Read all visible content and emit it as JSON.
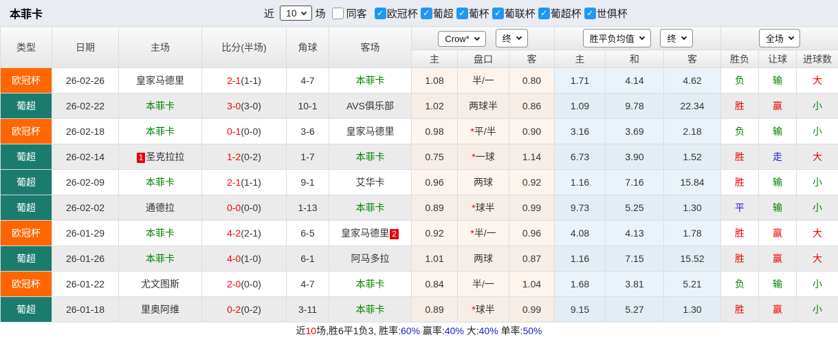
{
  "title": "本菲卡",
  "controls": {
    "recent_label": "近",
    "recent_value": "10",
    "matches_label": "场",
    "same_venue_label": "同客",
    "same_venue_checked": false,
    "leagues": [
      {
        "label": "欧冠杯",
        "checked": true
      },
      {
        "label": "葡超",
        "checked": true
      },
      {
        "label": "葡杯",
        "checked": true
      },
      {
        "label": "葡联杯",
        "checked": true
      },
      {
        "label": "葡超杯",
        "checked": true
      },
      {
        "label": "世俱杯",
        "checked": true
      }
    ]
  },
  "icons": {
    "check": "✓",
    "chevron_down": "v"
  },
  "colors": {
    "league": {
      "欧冠杯": "#ff6600",
      "葡超": "#1b7b6f"
    },
    "text": {
      "black": "#222222",
      "red": "#ee0000",
      "blue": "#1b1bcf",
      "green": "#008000"
    },
    "highlight_team": "#008000",
    "score_main": "#ff0000",
    "score_half": "#333333",
    "badge_bg": "#e60012"
  },
  "table": {
    "columns": {
      "type": "类型",
      "date": "日期",
      "home": "主场",
      "score": "比分(半场)",
      "corners": "角球",
      "away": "客场",
      "odds_home": "主",
      "odds_line": "盘口",
      "odds_away": "客",
      "avg_home": "主",
      "avg_draw": "和",
      "avg_away": "客",
      "result": "胜负",
      "handicap": "让球",
      "goals": "进球数"
    },
    "dropdowns": {
      "bookmaker": "Crow*",
      "odds_time": "终",
      "avg_metric": "胜平负均值",
      "avg_time": "终",
      "scope": "全场"
    },
    "rows": [
      {
        "league": "欧冠杯",
        "date": "26-02-26",
        "home": {
          "name": "皇家马德里",
          "hl": false
        },
        "score": "2-1",
        "half": "(1-1)",
        "corners": "4-7",
        "away": {
          "name": "本菲卡",
          "hl": true
        },
        "odds": [
          "1.08",
          "半/一",
          "0.80"
        ],
        "avg": [
          "1.71",
          "4.14",
          "4.62"
        ],
        "results": [
          {
            "text": "负",
            "color": "green"
          },
          {
            "text": "输",
            "color": "green"
          },
          {
            "text": "大",
            "color": "red"
          }
        ]
      },
      {
        "league": "葡超",
        "date": "26-02-22",
        "home": {
          "name": "本菲卡",
          "hl": true
        },
        "score": "3-0",
        "half": "(3-0)",
        "corners": "10-1",
        "away": {
          "name": "AVS俱乐部",
          "hl": false
        },
        "odds": [
          "1.02",
          "两球半",
          "0.86"
        ],
        "avg": [
          "1.09",
          "9.78",
          "22.34"
        ],
        "results": [
          {
            "text": "胜",
            "color": "red"
          },
          {
            "text": "赢",
            "color": "red"
          },
          {
            "text": "小",
            "color": "green"
          }
        ]
      },
      {
        "league": "欧冠杯",
        "date": "26-02-18",
        "home": {
          "name": "本菲卡",
          "hl": true
        },
        "score": "0-1",
        "half": "(0-0)",
        "corners": "3-6",
        "away": {
          "name": "皇家马德里",
          "hl": false
        },
        "odds": [
          "0.98",
          "*平/半",
          "0.90"
        ],
        "avg": [
          "3.16",
          "3.69",
          "2.18"
        ],
        "results": [
          {
            "text": "负",
            "color": "green"
          },
          {
            "text": "输",
            "color": "green"
          },
          {
            "text": "小",
            "color": "green"
          }
        ]
      },
      {
        "league": "葡超",
        "date": "26-02-14",
        "home": {
          "name": "圣克拉拉",
          "hl": false,
          "badge_before": "1"
        },
        "score": "1-2",
        "half": "(0-2)",
        "corners": "1-7",
        "away": {
          "name": "本菲卡",
          "hl": true
        },
        "odds": [
          "0.75",
          "*一球",
          "1.14"
        ],
        "avg": [
          "6.73",
          "3.90",
          "1.52"
        ],
        "results": [
          {
            "text": "胜",
            "color": "red"
          },
          {
            "text": "走",
            "color": "blue"
          },
          {
            "text": "大",
            "color": "red"
          }
        ]
      },
      {
        "league": "葡超",
        "date": "26-02-09",
        "home": {
          "name": "本菲卡",
          "hl": true
        },
        "score": "2-1",
        "half": "(1-1)",
        "corners": "9-1",
        "away": {
          "name": "艾华卡",
          "hl": false
        },
        "odds": [
          "0.96",
          "两球",
          "0.92"
        ],
        "avg": [
          "1.16",
          "7.16",
          "15.84"
        ],
        "results": [
          {
            "text": "胜",
            "color": "red"
          },
          {
            "text": "输",
            "color": "green"
          },
          {
            "text": "小",
            "color": "green"
          }
        ]
      },
      {
        "league": "葡超",
        "date": "26-02-02",
        "home": {
          "name": "通德拉",
          "hl": false
        },
        "score": "0-0",
        "half": "(0-0)",
        "corners": "1-13",
        "away": {
          "name": "本菲卡",
          "hl": true
        },
        "odds": [
          "0.89",
          "*球半",
          "0.99"
        ],
        "avg": [
          "9.73",
          "5.25",
          "1.30"
        ],
        "results": [
          {
            "text": "平",
            "color": "blue"
          },
          {
            "text": "输",
            "color": "green"
          },
          {
            "text": "小",
            "color": "green"
          }
        ]
      },
      {
        "league": "欧冠杯",
        "date": "26-01-29",
        "home": {
          "name": "本菲卡",
          "hl": true
        },
        "score": "4-2",
        "half": "(2-1)",
        "corners": "6-5",
        "away": {
          "name": "皇家马德里",
          "hl": false,
          "badge_after": "2"
        },
        "odds": [
          "0.92",
          "*半/一",
          "0.96"
        ],
        "avg": [
          "4.08",
          "4.13",
          "1.78"
        ],
        "results": [
          {
            "text": "胜",
            "color": "red"
          },
          {
            "text": "赢",
            "color": "red"
          },
          {
            "text": "大",
            "color": "red"
          }
        ]
      },
      {
        "league": "葡超",
        "date": "26-01-26",
        "home": {
          "name": "本菲卡",
          "hl": true
        },
        "score": "4-0",
        "half": "(1-0)",
        "corners": "6-1",
        "away": {
          "name": "阿马多拉",
          "hl": false
        },
        "odds": [
          "1.01",
          "两球",
          "0.87"
        ],
        "avg": [
          "1.16",
          "7.15",
          "15.52"
        ],
        "results": [
          {
            "text": "胜",
            "color": "red"
          },
          {
            "text": "赢",
            "color": "red"
          },
          {
            "text": "大",
            "color": "red"
          }
        ]
      },
      {
        "league": "欧冠杯",
        "date": "26-01-22",
        "home": {
          "name": "尤文图斯",
          "hl": false
        },
        "score": "2-0",
        "half": "(0-0)",
        "corners": "4-7",
        "away": {
          "name": "本菲卡",
          "hl": true
        },
        "odds": [
          "0.84",
          "半/一",
          "1.04"
        ],
        "avg": [
          "1.68",
          "3.81",
          "5.21"
        ],
        "results": [
          {
            "text": "负",
            "color": "green"
          },
          {
            "text": "输",
            "color": "green"
          },
          {
            "text": "小",
            "color": "green"
          }
        ]
      },
      {
        "league": "葡超",
        "date": "26-01-18",
        "home": {
          "name": "里奥阿维",
          "hl": false
        },
        "score": "0-2",
        "half": "(0-2)",
        "corners": "3-11",
        "away": {
          "name": "本菲卡",
          "hl": true
        },
        "odds": [
          "0.89",
          "*球半",
          "0.99"
        ],
        "avg": [
          "9.15",
          "5.27",
          "1.30"
        ],
        "results": [
          {
            "text": "胜",
            "color": "red"
          },
          {
            "text": "赢",
            "color": "red"
          },
          {
            "text": "小",
            "color": "green"
          }
        ]
      }
    ]
  },
  "footer": {
    "segments": [
      {
        "text": "近",
        "color": "black"
      },
      {
        "text": "10",
        "color": "red"
      },
      {
        "text": "场,胜6平1负3, 胜率:",
        "color": "black"
      },
      {
        "text": "60%",
        "color": "blue"
      },
      {
        "text": " 赢率:",
        "color": "black"
      },
      {
        "text": "40%",
        "color": "blue"
      },
      {
        "text": " 大:",
        "color": "black"
      },
      {
        "text": "40%",
        "color": "blue"
      },
      {
        "text": " 单率:",
        "color": "black"
      },
      {
        "text": "50%",
        "color": "blue"
      }
    ]
  }
}
